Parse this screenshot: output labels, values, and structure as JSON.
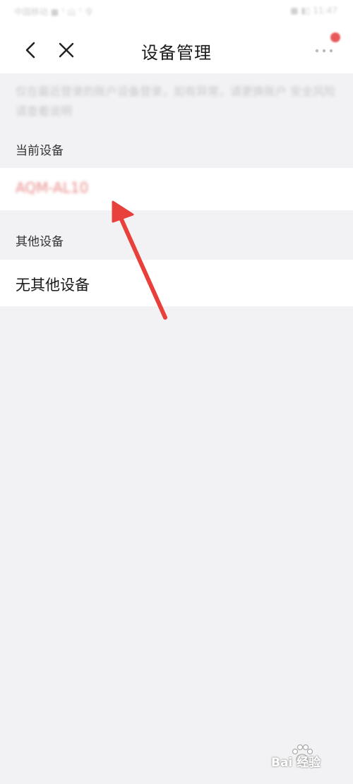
{
  "status_bar": {
    "left_text": "中国移动 ■ ᵀ 山 ᵀ 令",
    "right_text": "■ ▮▯ 11:47"
  },
  "nav": {
    "title": "设备管理",
    "back_icon": "chevron-left-icon",
    "close_icon": "close-icon",
    "more_icon": "more-horizontal-icon"
  },
  "notice": {
    "text": "仅在最近登录的账户设备登录，如有异常，请更换账户 安全风险请查看说明"
  },
  "sections": {
    "current_label": "当前设备",
    "current_device": "AQM-AL10",
    "other_label": "其他设备",
    "other_empty": "无其他设备"
  },
  "annotation": {
    "arrow_color": "#e8403a"
  },
  "watermark": {
    "text": "Bai 经验"
  }
}
